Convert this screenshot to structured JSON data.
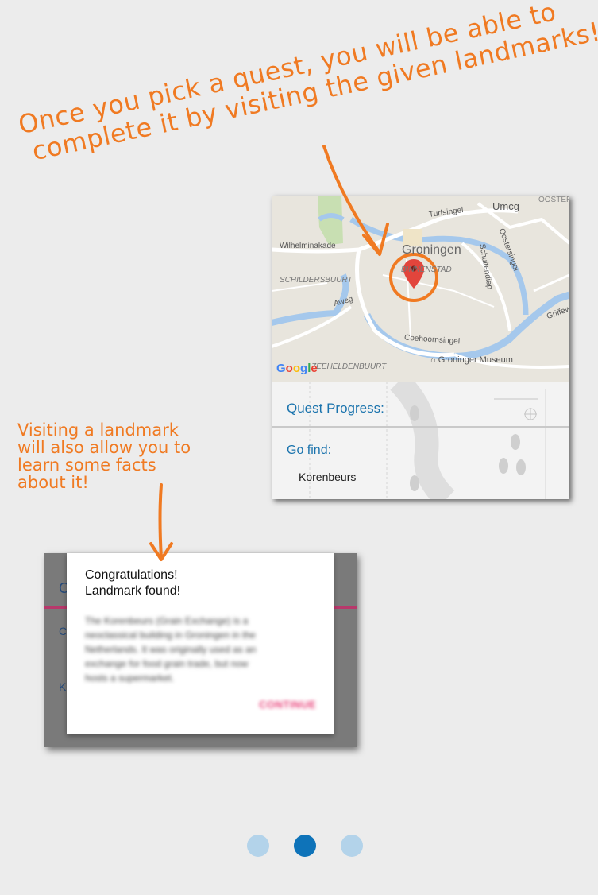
{
  "annotations": {
    "top_line1": "Once you pick a quest, you will be able to",
    "top_line2": "complete it by visiting the given landmarks!",
    "side_line1": "Visiting a landmark",
    "side_line2": "will also allow you to",
    "side_line3": "learn some facts",
    "side_line4": "about it!",
    "color": "#f07a22"
  },
  "map": {
    "labels": {
      "city": "Groningen",
      "district": "BINNENSTAD",
      "umcg": "Umcg",
      "ooster": "OOSTERP",
      "turfsingel": "Turfsingel",
      "oostersingel": "Oostersingel",
      "schuitendiep": "Schuitendiep",
      "wilhelminakade": "Wilhelminakade",
      "schildersbuurt": "SCHILDERSBUURT",
      "aweg": "Aweg",
      "coehoornsingel": "Coehoornsingel",
      "griffeweg": "Griffew",
      "zeeheldenbuurt": "ZEEHELDENBUURT",
      "museum": "Groninger Museum",
      "google": "Google"
    },
    "pin_icon": "map-pin-icon"
  },
  "quest": {
    "progress_label": "Quest Progress:",
    "go_find_label": "Go find:",
    "landmark": "Korenbeurs"
  },
  "dialog": {
    "title_line1": "Congratulations!",
    "title_line2": "Landmark found!",
    "body_line1": "The Korenbeurs (Grain Exchange) is a",
    "body_line2": "neoclassical building in Groningen in the",
    "body_line3": "Netherlands. It was originally used as an",
    "body_line4": "exchange for food grain trade, but now",
    "body_line5": "hosts a supermarket.",
    "button": "CONTINUE",
    "behind_letter1": "C",
    "behind_letter2": "C",
    "behind_letter3": "K"
  },
  "pagination": {
    "total": 3,
    "active_index": 1,
    "active_color": "#0e73b9",
    "inactive_color": "#b3d3ea"
  }
}
